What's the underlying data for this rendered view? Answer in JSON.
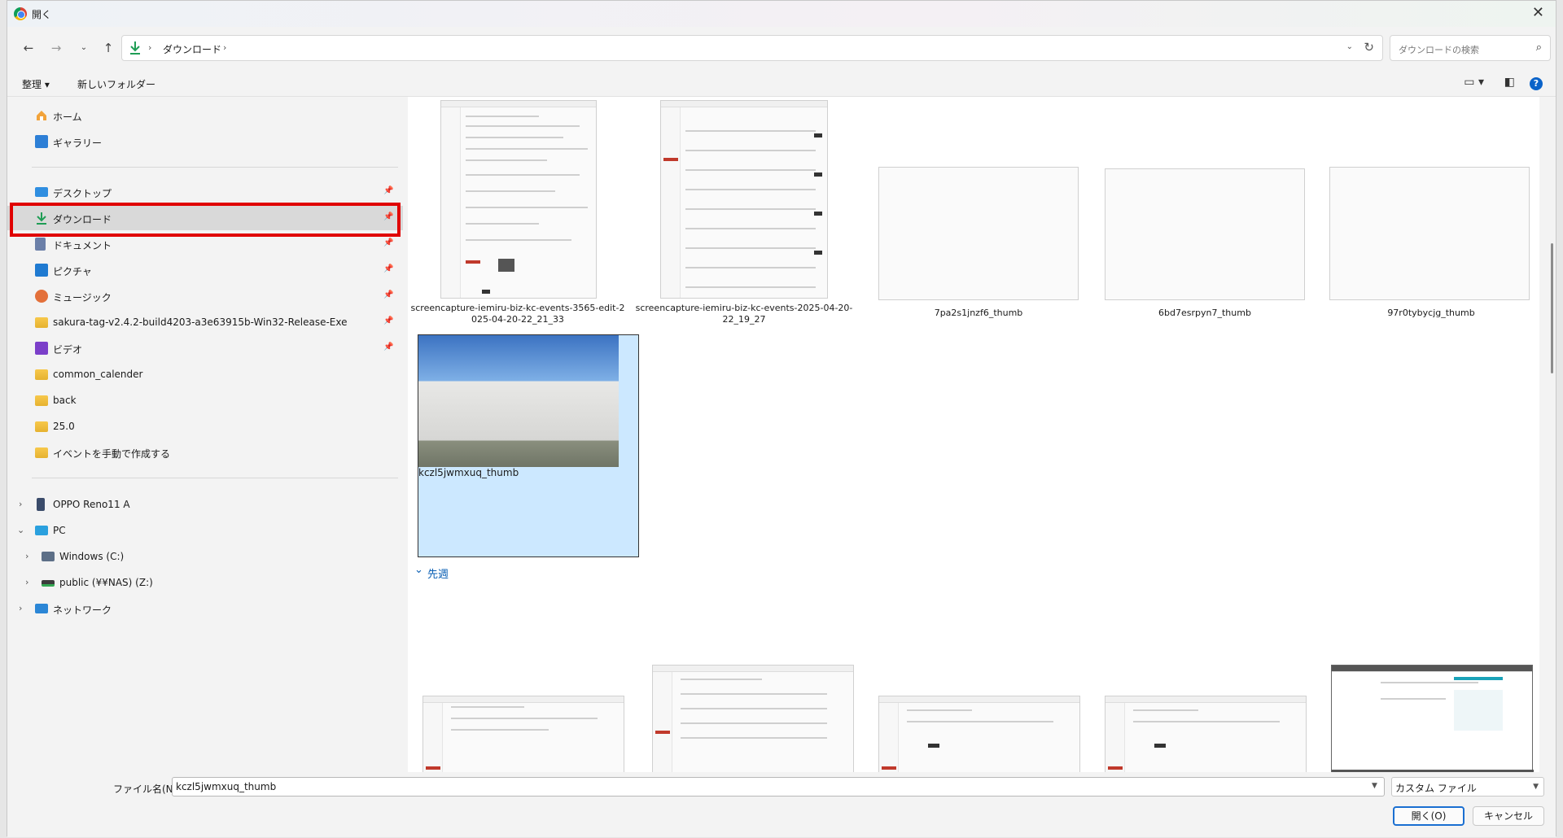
{
  "window": {
    "title": "開く"
  },
  "address": {
    "crumb": "ダウンロード",
    "search_placeholder": "ダウンロードの検索"
  },
  "commands": {
    "organize": "整理 ▾",
    "new_folder": "新しいフォルダー"
  },
  "sidebar": {
    "quick": [
      "ホーム",
      "ギャラリー"
    ],
    "pinned": [
      "デスクトップ",
      "ダウンロード",
      "ドキュメント",
      "ピクチャ",
      "ミュージック",
      "sakura-tag-v2.4.2-build4203-a3e63915b-Win32-Release-Exe",
      "ビデオ"
    ],
    "folders": [
      "common_calender",
      "back",
      "25.0",
      "イベントを手動で作成する"
    ],
    "devices": [
      "OPPO Reno11 A",
      "PC",
      "Windows (C:)",
      "public (¥¥NAS) (Z:)",
      "ネットワーク"
    ]
  },
  "files": [
    {
      "line1": "screencapture-iemiru-biz-kc-events-3565-edit-2",
      "line2": "025-04-20-22_21_33"
    },
    {
      "line1": "screencapture-iemiru-biz-kc-events-2025-04-20-",
      "line2": "22_19_27"
    },
    {
      "line1": "7pa2s1jnzf6_thumb",
      "line2": ""
    },
    {
      "line1": "6bd7esrpyn7_thumb",
      "line2": ""
    },
    {
      "line1": "97r0tybycjg_thumb",
      "line2": ""
    },
    {
      "line1": "kczl5jwmxuq_thumb",
      "line2": ""
    }
  ],
  "section": {
    "last_week": "先週"
  },
  "bottom": {
    "filename_label": "ファイル名(N):",
    "filename_value": "kczl5jwmxuq_thumb",
    "filetype": "カスタム ファイル",
    "open": "開く(O)",
    "cancel": "キャンセル"
  }
}
